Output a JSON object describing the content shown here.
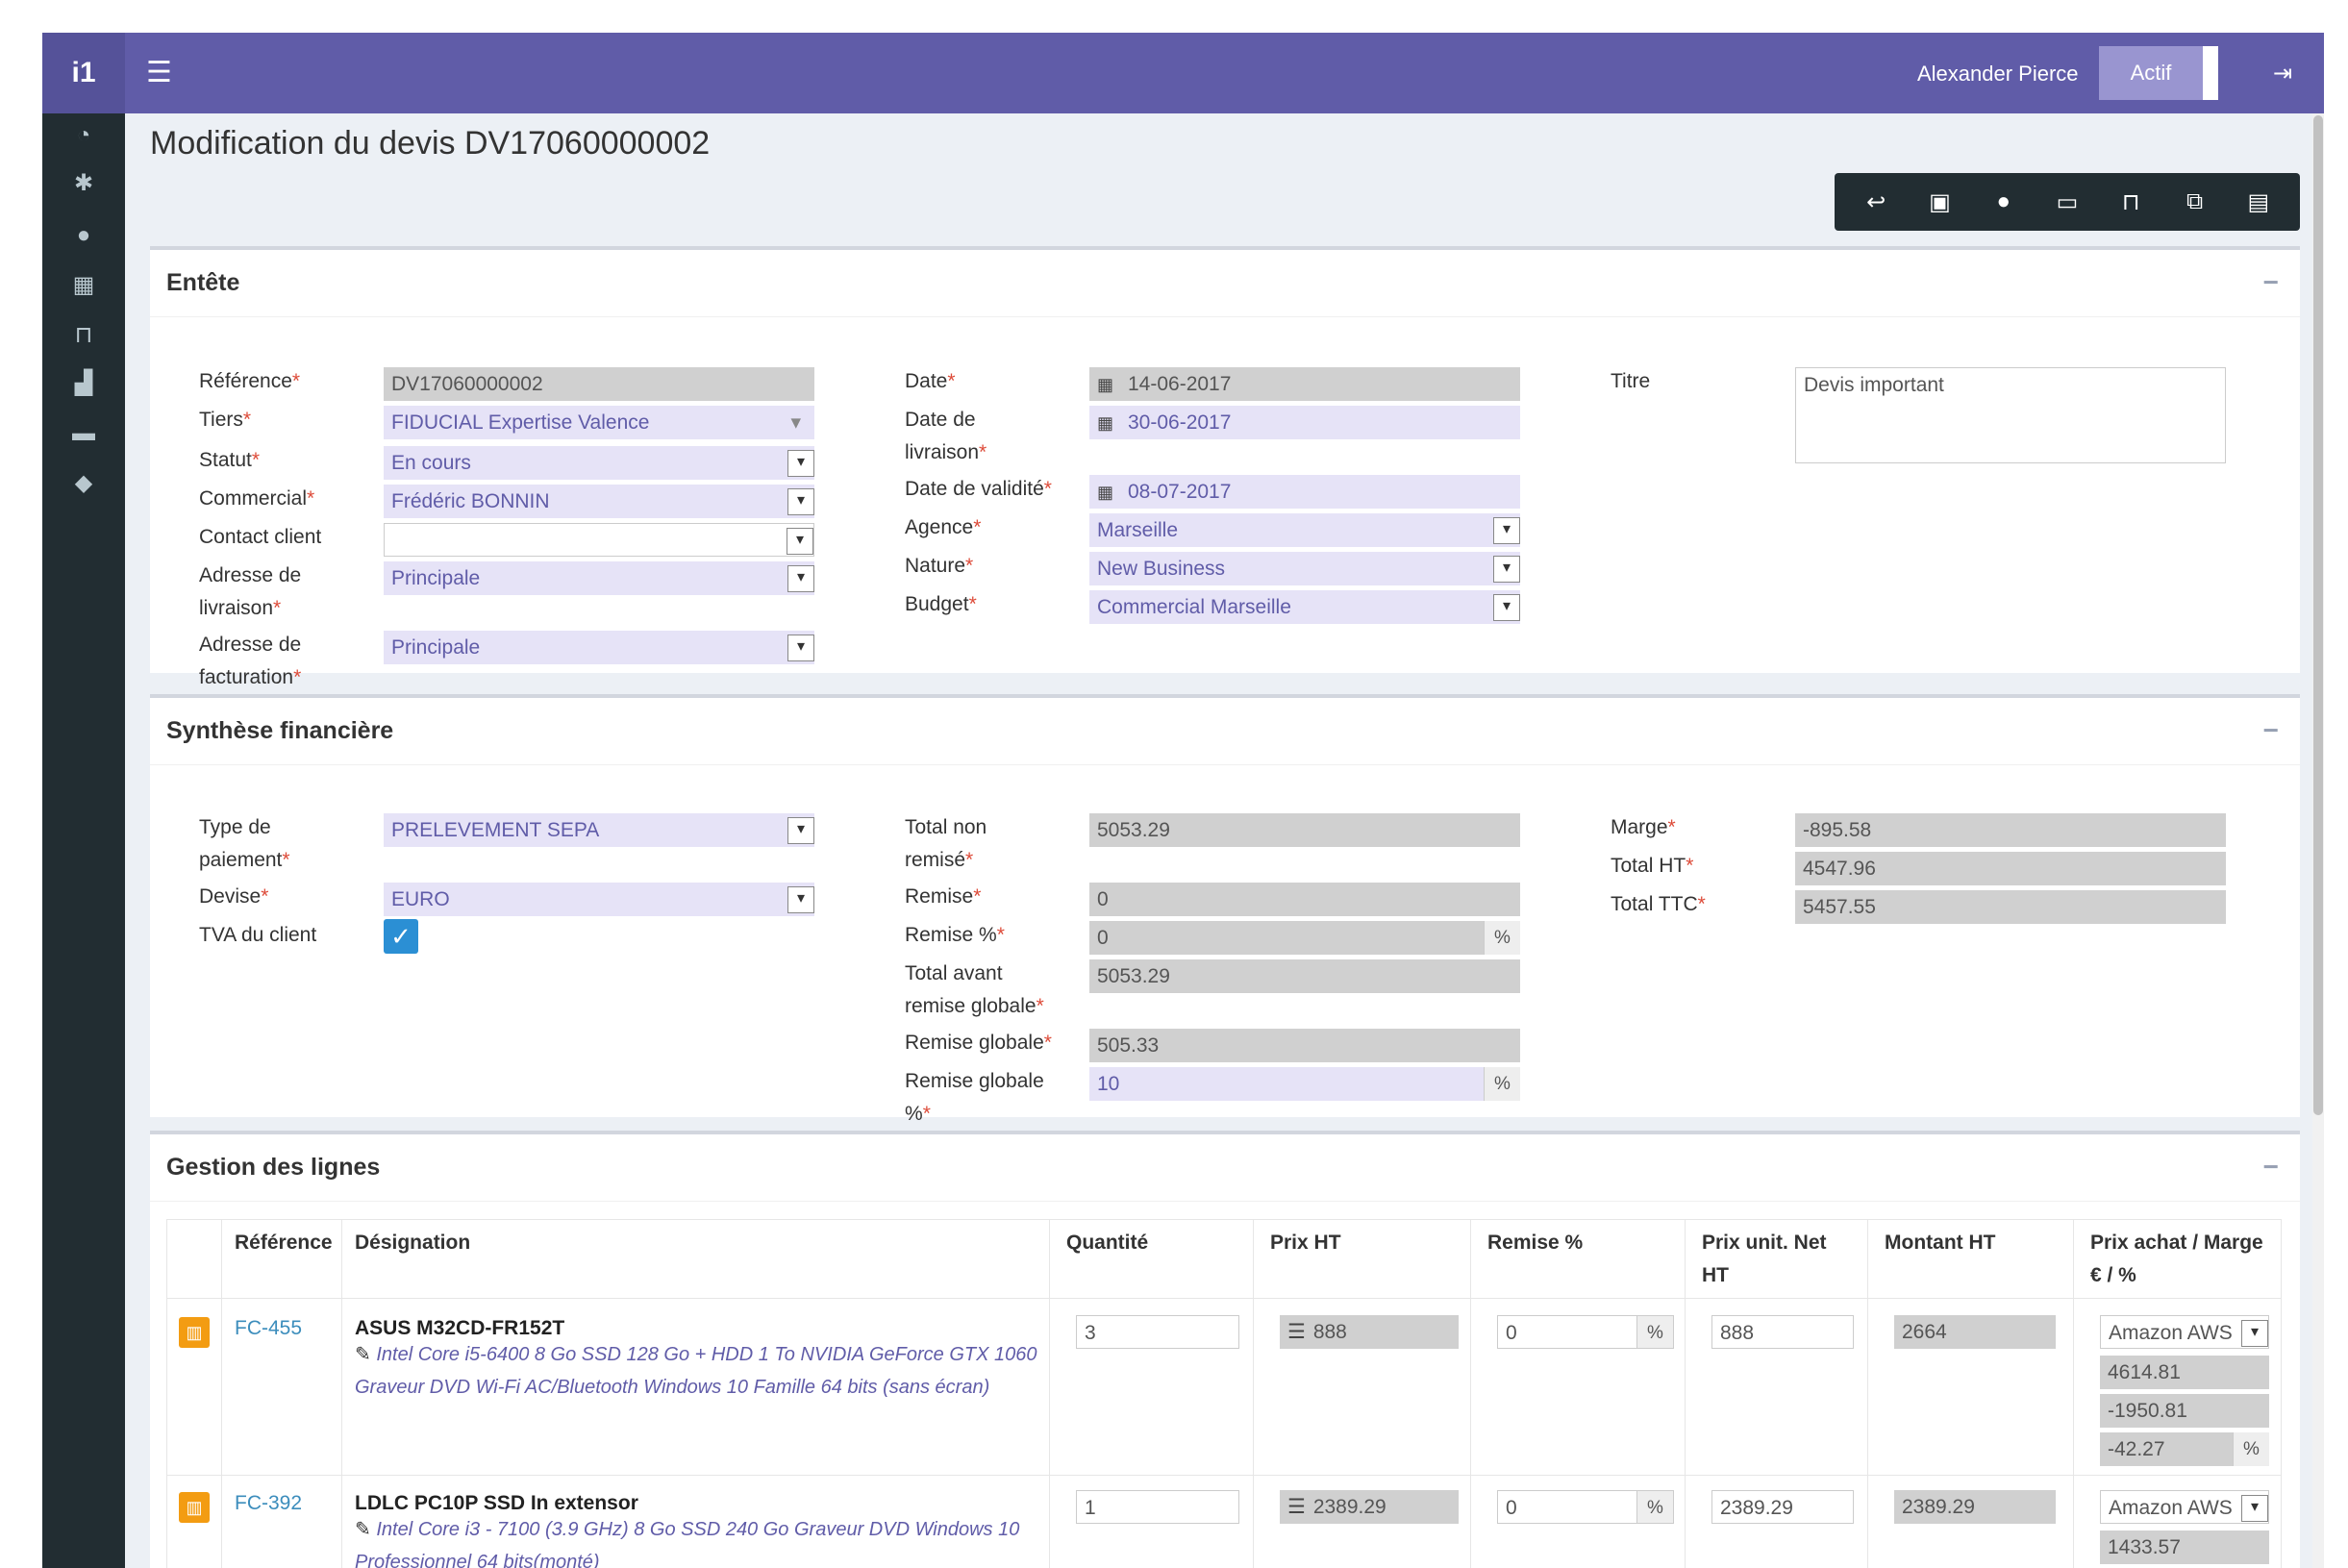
{
  "header": {
    "logo": "i1",
    "user_name": "Alexander Pierce",
    "status_button": "Actif"
  },
  "sidebar": {
    "icons": [
      "dashboard-icon",
      "cog-icon",
      "user-icon",
      "calculator-icon",
      "cart-icon",
      "chart-icon",
      "briefcase-icon",
      "tag-icon"
    ]
  },
  "page": {
    "title": "Modification du devis DV17060000002"
  },
  "toolbar": {
    "icons": [
      "reply-icon",
      "briefcase-icon",
      "comment-icon",
      "money-icon",
      "cart-icon",
      "copy-icon",
      "save-icon"
    ]
  },
  "entete": {
    "title": "Entête",
    "labels": {
      "reference": "Référence",
      "tiers": "Tiers",
      "statut": "Statut",
      "commercial": "Commercial",
      "contact": "Contact client",
      "adresse_livraison_1": "Adresse de",
      "adresse_livraison_2": "livraison",
      "adresse_facturation_1": "Adresse de",
      "adresse_facturation_2": "facturation",
      "date": "Date",
      "date_livraison_1": "Date de",
      "date_livraison_2": "livraison",
      "date_validite": "Date de validité",
      "agence": "Agence",
      "nature": "Nature",
      "budget": "Budget",
      "titre": "Titre"
    },
    "values": {
      "reference": "DV17060000002",
      "tiers": "FIDUCIAL Expertise Valence",
      "statut": "En cours",
      "commercial": "Frédéric BONNIN",
      "contact": "",
      "adresse_livraison": "Principale",
      "adresse_facturation": "Principale",
      "date": "14-06-2017",
      "date_livraison": "30-06-2017",
      "date_validite": "08-07-2017",
      "agence": "Marseille",
      "nature": "New Business",
      "budget": "Commercial Marseille",
      "titre": "Devis important"
    }
  },
  "synthese": {
    "title": "Synthèse financière",
    "labels": {
      "type_paiement_1": "Type de",
      "type_paiement_2": "paiement",
      "devise": "Devise",
      "tva": "TVA du client",
      "total_non_remise_1": "Total non",
      "total_non_remise_2": "remisé",
      "remise": "Remise",
      "remise_pct": "Remise %",
      "total_avant_1": "Total avant",
      "total_avant_2": "remise globale",
      "remise_globale": "Remise globale",
      "remise_globale_pct_1": "Remise globale",
      "remise_globale_pct_2": "%",
      "marge": "Marge",
      "total_ht": "Total HT",
      "total_ttc": "Total TTC"
    },
    "values": {
      "type_paiement": "PRELEVEMENT SEPA",
      "devise": "EURO",
      "total_non_remise": "5053.29",
      "remise": "0",
      "remise_pct": "0",
      "total_avant": "5053.29",
      "remise_globale": "505.33",
      "remise_globale_pct": "10",
      "marge": "-895.58",
      "total_ht": "4547.96",
      "total_ttc": "5457.55"
    },
    "pct_symbol": "%"
  },
  "lignes": {
    "title": "Gestion des lignes",
    "columns": {
      "reference": "Référence",
      "designation": "Désignation",
      "quantite": "Quantité",
      "prix_ht": "Prix HT",
      "remise": "Remise %",
      "prix_net_1": "Prix unit. Net",
      "prix_net_2": "HT",
      "montant": "Montant HT",
      "achat_1": "Prix achat / Marge",
      "achat_2": "€ / %"
    },
    "rows": [
      {
        "ref": "FC-455",
        "name": "ASUS M32CD-FR152T",
        "desc_1": "Intel Core i5-6400 8 Go SSD 128 Go + HDD 1 To NVIDIA GeForce GTX 1060",
        "desc_2": "Graveur DVD Wi-Fi AC/Bluetooth Windows 10 Famille 64 bits (sans écran)",
        "quantite": "3",
        "prix_ht": "888",
        "remise": "0",
        "prix_net": "888",
        "montant": "2664",
        "fournisseur": "Amazon AWS",
        "prix_achat": "4614.81",
        "marge": "-1950.81",
        "marge_pct": "-42.27"
      },
      {
        "ref": "FC-392",
        "name": "LDLC PC10P SSD In extensor",
        "desc_1": "Intel Core i3 - 7100 (3.9 GHz) 8 Go SSD 240 Go Graveur DVD Windows 10",
        "desc_2": "Professionnel 64 bits(monté)",
        "quantite": "1",
        "prix_ht": "2389.29",
        "remise": "0",
        "prix_net": "2389.29",
        "montant": "2389.29",
        "fournisseur": "Amazon AWS",
        "prix_achat": "1433.57"
      }
    ]
  }
}
